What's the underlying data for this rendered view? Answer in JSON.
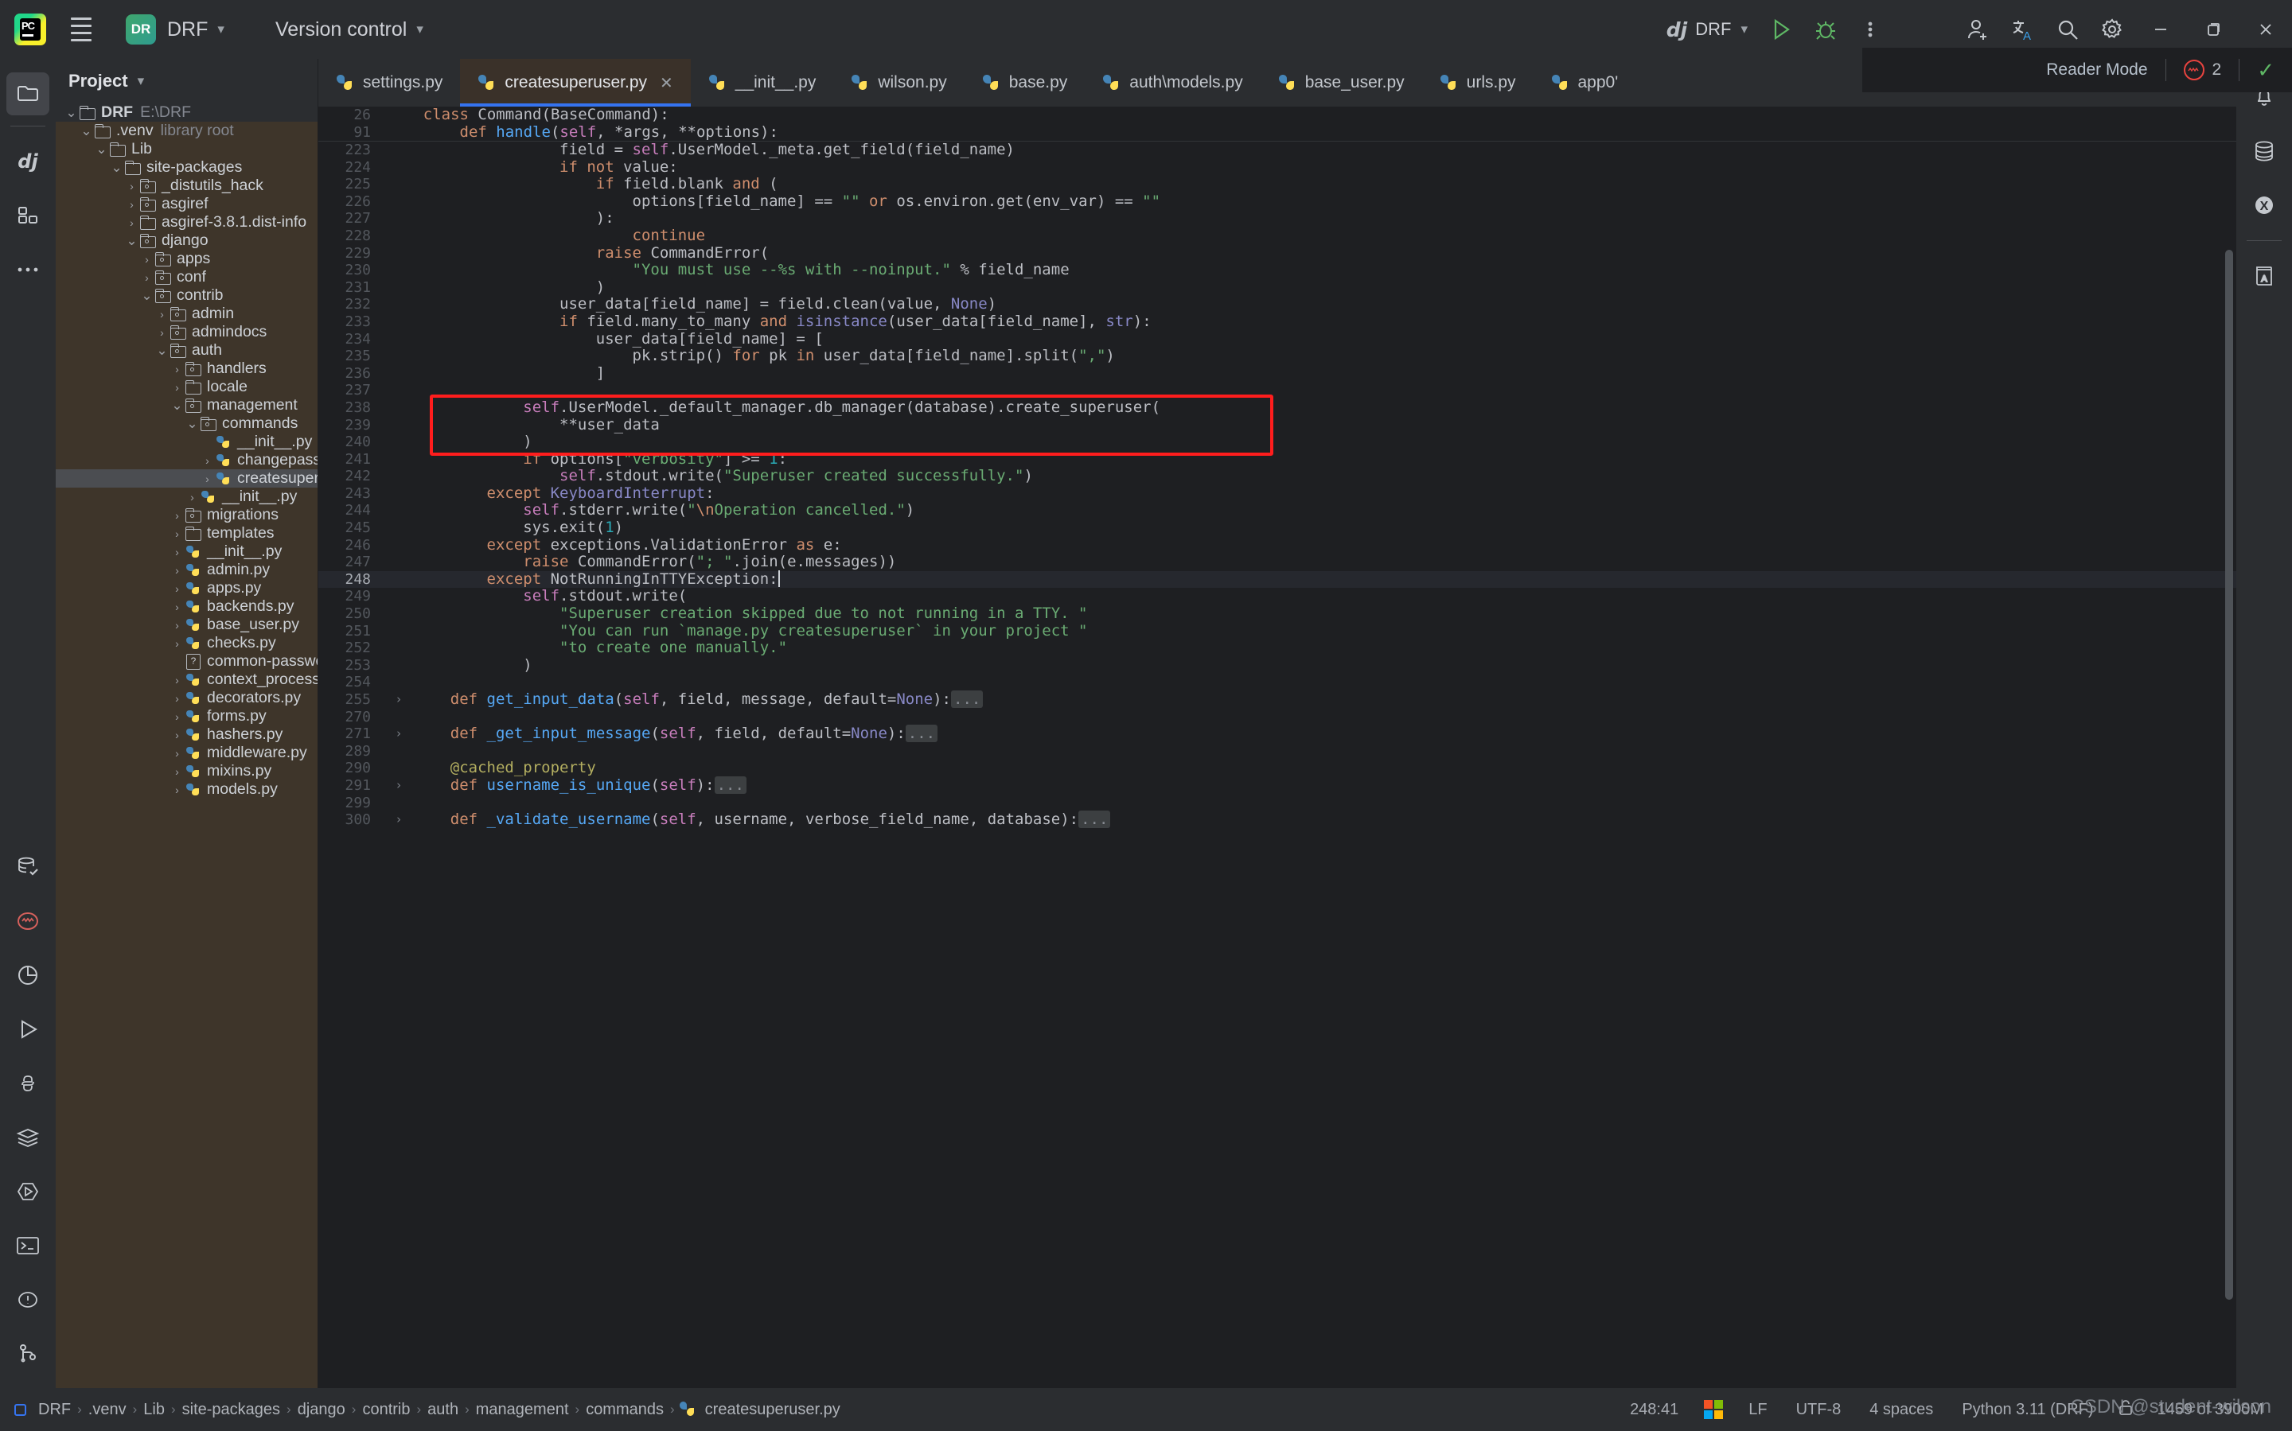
{
  "titlebar": {
    "app_icon": "pycharm-logo",
    "menu_icon": "hamburger-menu-icon",
    "project_badge": "DR",
    "project_name": "DRF",
    "version_control": "Version control",
    "run_config": "DRF",
    "run_config_prefix": "dj",
    "icons": [
      "run-icon",
      "debug-icon",
      "more-actions-icon",
      "add-user-icon",
      "translate-icon",
      "search-icon",
      "settings-icon"
    ],
    "window_buttons": [
      "minimize",
      "maximize",
      "close"
    ]
  },
  "left_toolbar": {
    "items": [
      {
        "name": "project-tool-window",
        "icon": "folder-icon",
        "selected": true
      },
      {
        "name": "django-tool-window",
        "icon": "django-icon",
        "selected": false
      },
      {
        "name": "structure-tool-window",
        "icon": "structure-icon",
        "selected": false
      },
      {
        "name": "more-tool-windows",
        "icon": "more-dots-icon",
        "selected": false
      }
    ],
    "bottom_items": [
      {
        "name": "database-tool-window",
        "icon": "database-check-icon"
      },
      {
        "name": "problems-tool-window",
        "icon": "problems-circle-icon"
      },
      {
        "name": "profiler-tool-window",
        "icon": "pie-chart-icon"
      },
      {
        "name": "run-tool-window",
        "icon": "play-icon"
      },
      {
        "name": "python-console-tool-window",
        "icon": "python-icon"
      },
      {
        "name": "services-tool-window",
        "icon": "layers-icon"
      },
      {
        "name": "endpoints-tool-window",
        "icon": "hexagon-play-icon"
      },
      {
        "name": "terminal-tool-window",
        "icon": "terminal-icon"
      },
      {
        "name": "warnings-tool-window",
        "icon": "exclamation-circle-icon"
      },
      {
        "name": "git-tool-window",
        "icon": "branch-icon"
      }
    ]
  },
  "right_toolbar": {
    "items": [
      {
        "name": "notifications",
        "icon": "bell-icon",
        "badge": true
      },
      {
        "name": "database",
        "icon": "database-icon"
      },
      {
        "name": "plugin-x",
        "icon": "circle-x-icon"
      },
      {
        "name": "dictionary",
        "icon": "book-a-icon"
      }
    ]
  },
  "project_pane": {
    "title": "Project",
    "chevron": "chevron-down-icon",
    "tree": [
      {
        "depth": 0,
        "arrow": "v",
        "icon": "folder",
        "label": "DRF",
        "bold": true,
        "sub": "E:\\DRF",
        "lib": false
      },
      {
        "depth": 1,
        "arrow": "v",
        "icon": "folder",
        "label": ".venv",
        "sub": "library root",
        "lib": true
      },
      {
        "depth": 2,
        "arrow": "v",
        "icon": "folder",
        "label": "Lib",
        "lib": true
      },
      {
        "depth": 3,
        "arrow": "v",
        "icon": "folder",
        "label": "site-packages",
        "lib": true
      },
      {
        "depth": 4,
        "arrow": ">",
        "icon": "pkg",
        "label": "_distutils_hack",
        "lib": true
      },
      {
        "depth": 4,
        "arrow": ">",
        "icon": "pkg",
        "label": "asgiref",
        "lib": true
      },
      {
        "depth": 4,
        "arrow": ">",
        "icon": "folder",
        "label": "asgiref-3.8.1.dist-info",
        "lib": true
      },
      {
        "depth": 4,
        "arrow": "v",
        "icon": "pkg",
        "label": "django",
        "lib": true
      },
      {
        "depth": 5,
        "arrow": ">",
        "icon": "pkg",
        "label": "apps",
        "lib": true
      },
      {
        "depth": 5,
        "arrow": ">",
        "icon": "pkg",
        "label": "conf",
        "lib": true
      },
      {
        "depth": 5,
        "arrow": "v",
        "icon": "pkg",
        "label": "contrib",
        "lib": true
      },
      {
        "depth": 6,
        "arrow": ">",
        "icon": "pkg",
        "label": "admin",
        "lib": true
      },
      {
        "depth": 6,
        "arrow": ">",
        "icon": "pkg",
        "label": "admindocs",
        "lib": true
      },
      {
        "depth": 6,
        "arrow": "v",
        "icon": "pkg",
        "label": "auth",
        "lib": true
      },
      {
        "depth": 7,
        "arrow": ">",
        "icon": "pkg",
        "label": "handlers",
        "lib": true
      },
      {
        "depth": 7,
        "arrow": ">",
        "icon": "folder",
        "label": "locale",
        "lib": true
      },
      {
        "depth": 7,
        "arrow": "v",
        "icon": "pkg",
        "label": "management",
        "lib": true
      },
      {
        "depth": 8,
        "arrow": "v",
        "icon": "pkg",
        "label": "commands",
        "lib": true
      },
      {
        "depth": 9,
        "arrow": "",
        "icon": "py",
        "label": "__init__.py",
        "lib": true
      },
      {
        "depth": 9,
        "arrow": ">",
        "icon": "py",
        "label": "changepassword.py",
        "lib": true
      },
      {
        "depth": 9,
        "arrow": ">",
        "icon": "py",
        "label": "createsuperuser.py",
        "lib": true,
        "selected": true
      },
      {
        "depth": 8,
        "arrow": ">",
        "icon": "py",
        "label": "__init__.py",
        "lib": true
      },
      {
        "depth": 7,
        "arrow": ">",
        "icon": "pkg",
        "label": "migrations",
        "lib": true
      },
      {
        "depth": 7,
        "arrow": ">",
        "icon": "folder",
        "label": "templates",
        "lib": true
      },
      {
        "depth": 7,
        "arrow": ">",
        "icon": "py",
        "label": "__init__.py",
        "lib": true
      },
      {
        "depth": 7,
        "arrow": ">",
        "icon": "py",
        "label": "admin.py",
        "lib": true
      },
      {
        "depth": 7,
        "arrow": ">",
        "icon": "py",
        "label": "apps.py",
        "lib": true
      },
      {
        "depth": 7,
        "arrow": ">",
        "icon": "py",
        "label": "backends.py",
        "lib": true
      },
      {
        "depth": 7,
        "arrow": ">",
        "icon": "py",
        "label": "base_user.py",
        "lib": true
      },
      {
        "depth": 7,
        "arrow": ">",
        "icon": "py",
        "label": "checks.py",
        "lib": true
      },
      {
        "depth": 7,
        "arrow": "",
        "icon": "unk",
        "label": "common-passwords.txt.gz",
        "lib": true
      },
      {
        "depth": 7,
        "arrow": ">",
        "icon": "py",
        "label": "context_processors.py",
        "lib": true
      },
      {
        "depth": 7,
        "arrow": ">",
        "icon": "py",
        "label": "decorators.py",
        "lib": true
      },
      {
        "depth": 7,
        "arrow": ">",
        "icon": "py",
        "label": "forms.py",
        "lib": true
      },
      {
        "depth": 7,
        "arrow": ">",
        "icon": "py",
        "label": "hashers.py",
        "lib": true
      },
      {
        "depth": 7,
        "arrow": ">",
        "icon": "py",
        "label": "middleware.py",
        "lib": true
      },
      {
        "depth": 7,
        "arrow": ">",
        "icon": "py",
        "label": "mixins.py",
        "lib": true
      },
      {
        "depth": 7,
        "arrow": ">",
        "icon": "py",
        "label": "models.py",
        "lib": true
      }
    ]
  },
  "tabs": [
    {
      "label": "settings.py",
      "active": false
    },
    {
      "label": "createsuperuser.py",
      "active": true,
      "closable": true
    },
    {
      "label": "__init__.py",
      "active": false
    },
    {
      "label": "wilson.py",
      "active": false
    },
    {
      "label": "base.py",
      "active": false
    },
    {
      "label": "auth\\models.py",
      "active": false
    },
    {
      "label": "base_user.py",
      "active": false
    },
    {
      "label": "urls.py",
      "active": false
    },
    {
      "label": "app0'",
      "active": false
    }
  ],
  "tab_actions": {
    "list_chevron": "chevron-down-icon",
    "more": "more-actions-icon"
  },
  "editor_header": {
    "reader_mode": "Reader Mode",
    "error_count": "2",
    "inspection_ok": "check-icon"
  },
  "sticky_lines": [
    {
      "num": "26",
      "html": "    <span class=\"kw\">class</span> <span class=\"cls\">Command</span>(<span class=\"cls\">BaseCommand</span>):"
    },
    {
      "num": "91",
      "html": "        <span class=\"kw\">def</span> <span class=\"fn\">handle</span>(<span class=\"self\">self</span>, *args, **options):"
    }
  ],
  "code_lines": [
    {
      "num": "223",
      "html": "                field = <span class=\"self\">self</span>.UserModel._meta.get_field(field_name)",
      "partial": true
    },
    {
      "num": "224",
      "html": "                <span class=\"kw\">if not</span> value:"
    },
    {
      "num": "225",
      "html": "                    <span class=\"kw\">if</span> field.blank <span class=\"kw\">and</span> ("
    },
    {
      "num": "226",
      "html": "                        options[field_name] == <span class=\"str\">\"\"</span> <span class=\"kw\">or</span> os.environ.get(env_var) == <span class=\"str\">\"\"</span>"
    },
    {
      "num": "227",
      "html": "                    ):"
    },
    {
      "num": "228",
      "html": "                        <span class=\"kw\">continue</span>"
    },
    {
      "num": "229",
      "html": "                    <span class=\"kw\">raise</span> <span class=\"cls\">CommandError</span>("
    },
    {
      "num": "230",
      "html": "                        <span class=\"str\">\"You must use --%s with --noinput.\"</span> % field_name"
    },
    {
      "num": "231",
      "html": "                    )"
    },
    {
      "num": "232",
      "html": "                user_data[field_name] = field.clean(value, <span class=\"bi\">None</span>)"
    },
    {
      "num": "233",
      "html": "                <span class=\"kw\">if</span> field.many_to_many <span class=\"kw\">and</span> <span class=\"bi\">isinstance</span>(user_data[field_name], <span class=\"bi\">str</span>):"
    },
    {
      "num": "234",
      "html": "                    user_data[field_name] = ["
    },
    {
      "num": "235",
      "html": "                        pk.strip() <span class=\"kw\">for</span> pk <span class=\"kw\">in</span> user_data[field_name].split(<span class=\"str\">\",\"</span>)"
    },
    {
      "num": "236",
      "html": "                    ]"
    },
    {
      "num": "237",
      "html": ""
    },
    {
      "num": "238",
      "html": "            <span class=\"self\">self</span>.UserModel._default_manager.db_manager(database).create_superuser("
    },
    {
      "num": "239",
      "html": "                **user_data"
    },
    {
      "num": "240",
      "html": "            )"
    },
    {
      "num": "241",
      "html": "            <span class=\"kw\">if</span> options[<span class=\"str\">\"verbosity\"</span>] &gt;= <span class=\"num\">1</span>:"
    },
    {
      "num": "242",
      "html": "                <span class=\"self\">self</span>.stdout.write(<span class=\"str\">\"Superuser created successfully.\"</span>)"
    },
    {
      "num": "243",
      "html": "        <span class=\"kw\">except</span> <span class=\"bi\">KeyboardInterrupt</span>:"
    },
    {
      "num": "244",
      "html": "            <span class=\"self\">self</span>.stderr.write(<span class=\"str\">\"</span><span class=\"esc\">\\n</span><span class=\"str\">Operation cancelled.\"</span>)"
    },
    {
      "num": "245",
      "html": "            sys.exit(<span class=\"num\">1</span>)"
    },
    {
      "num": "246",
      "html": "        <span class=\"kw\">except</span> exceptions.ValidationError <span class=\"kw\">as</span> e:"
    },
    {
      "num": "247",
      "html": "            <span class=\"kw\">raise</span> <span class=\"cls\">CommandError</span>(<span class=\"str\">\"; \"</span>.join(e.messages))"
    },
    {
      "num": "248",
      "html": "        <span class=\"kw\">except</span> <span class=\"cls\">NotRunningInTTYException</span>:<span class=\"caretbar\"></span>",
      "caret": true
    },
    {
      "num": "249",
      "html": "            <span class=\"self\">self</span>.stdout.write("
    },
    {
      "num": "250",
      "html": "                <span class=\"str\">\"Superuser creation skipped due to not running in a TTY. \"</span>"
    },
    {
      "num": "251",
      "html": "                <span class=\"str\">\"You can run `manage.py createsuperuser` in your project \"</span>"
    },
    {
      "num": "252",
      "html": "                <span class=\"str\">\"to create one manually.\"</span>"
    },
    {
      "num": "253",
      "html": "            )"
    },
    {
      "num": "254",
      "html": ""
    },
    {
      "num": "255",
      "html": "    <span class=\"kw\">def</span> <span class=\"fn\">get_input_data</span>(<span class=\"self\">self</span>, field, message, default=<span class=\"bi\">None</span>):<span class=\"foldchip\">...</span>",
      "fold": ">"
    },
    {
      "num": "270",
      "html": ""
    },
    {
      "num": "271",
      "html": "    <span class=\"kw\">def</span> <span class=\"fn\">_get_input_message</span>(<span class=\"self\">self</span>, field, default=<span class=\"bi\">None</span>):<span class=\"foldchip\">...</span>",
      "fold": ">"
    },
    {
      "num": "289",
      "html": ""
    },
    {
      "num": "290",
      "html": "    <span class=\"dec\">@cached_property</span>"
    },
    {
      "num": "291",
      "html": "    <span class=\"kw\">def</span> <span class=\"fn\">username_is_unique</span>(<span class=\"self\">self</span>):<span class=\"foldchip\">...</span>",
      "fold": ">"
    },
    {
      "num": "299",
      "html": ""
    },
    {
      "num": "300",
      "html": "    <span class=\"kw\">def</span> <span class=\"fn\">_validate_username</span>(<span class=\"self\">self</span>, username, verbose_field_name, database):<span class=\"foldchip\">...</span>",
      "fold": ">"
    }
  ],
  "annotation": {
    "type": "red-rectangle",
    "color": "#ff1d1d",
    "covers_lines": [
      "238",
      "239",
      "240"
    ]
  },
  "statusbar": {
    "breadcrumb": [
      "DRF",
      ".venv",
      "Lib",
      "site-packages",
      "django",
      "contrib",
      "auth",
      "management",
      "commands",
      "createsuperuser.py"
    ],
    "caret_position": "248:41",
    "os_icon": "windows-logo-icon",
    "line_separator": "LF",
    "encoding": "UTF-8",
    "indent": "4 spaces",
    "interpreter": "Python 3.11 (DRF)",
    "lock_icon": "lock-icon",
    "memory": "1459 of 3900M"
  },
  "watermark": "CSDN @student-wilson"
}
